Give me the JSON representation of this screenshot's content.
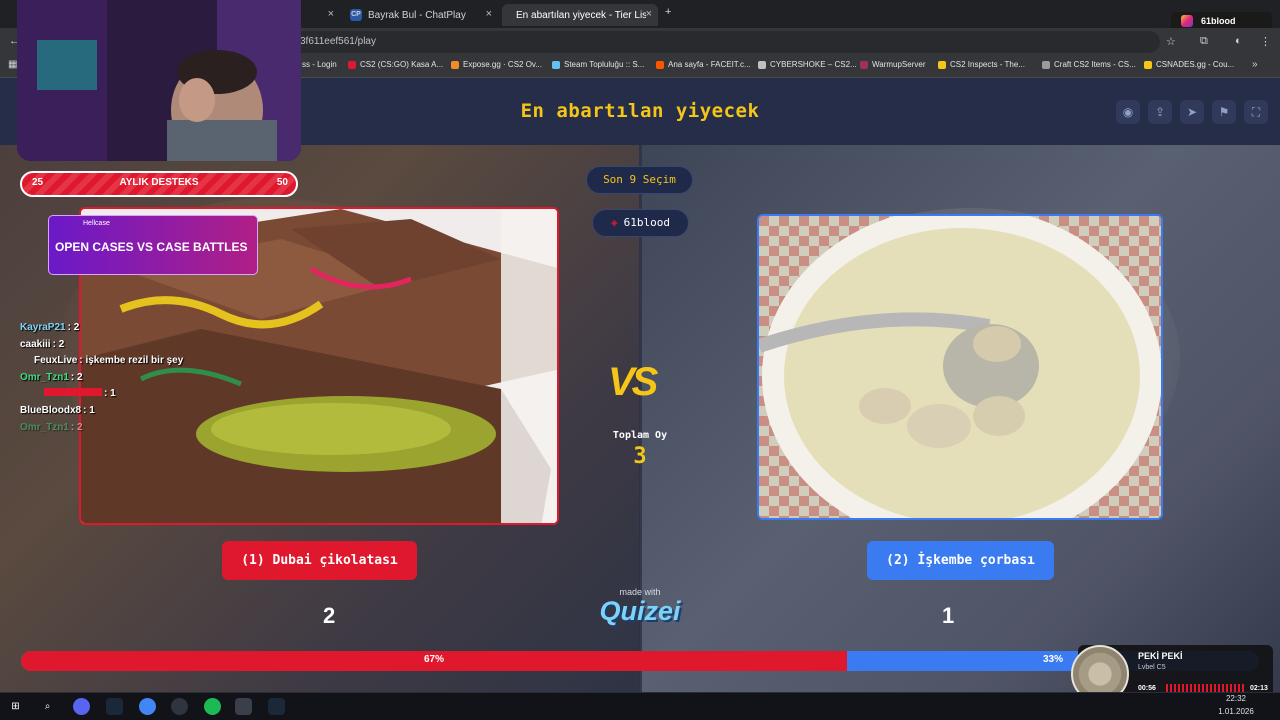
{
  "browser": {
    "tabs": [
      {
        "label": "",
        "icon": "tab-icon"
      },
      {
        "label": "Bayrak Bul - ChatPlay",
        "icon": "CP"
      },
      {
        "label": "En abartılan yiyecek - Tier List, ",
        "icon": "quizei-icon"
      }
    ],
    "new_tab": "+",
    "address": "3f611eef561/play",
    "bookmarks": [
      {
        "label": "ss - Login",
        "color": "#8ab4f8"
      },
      {
        "label": "CS2 (CS:GO) Kasa A...",
        "color": "#e0182d"
      },
      {
        "label": "Expose.gg · CS2 Ov...",
        "color": "#f28c28"
      },
      {
        "label": "Steam Topluluğu :: S...",
        "color": "#66c0f4"
      },
      {
        "label": "Ana sayfa - FACEIT.c...",
        "color": "#ff5500"
      },
      {
        "label": "CYBERSHOKE – CS2...",
        "color": "#c0c0c0"
      },
      {
        "label": "WarmupServer",
        "color": "#a03060"
      },
      {
        "label": "CS2 Inspects - The...",
        "color": "#f5c518"
      },
      {
        "label": "Craft CS2 Items - CS...",
        "color": "#9b9b9b"
      },
      {
        "label": "CSNADES.gg - Cou...",
        "color": "#f5c518"
      }
    ]
  },
  "quiz": {
    "title": "En abartılan yiyecek",
    "last_choices": "Son 9 Seçim",
    "user": "61blood",
    "vs": "VS",
    "total_label": "Toplam Oy",
    "total_value": "3",
    "made_with": "made with",
    "brand": "Quizei",
    "left": {
      "label": "(1) Dubai çikolatası",
      "count": "2",
      "percent": "67%",
      "share": 0.667,
      "color": "#e0182d"
    },
    "right": {
      "label": "(2) İşkembe çorbası",
      "count": "1",
      "percent": "33%",
      "share": 0.333,
      "color": "#3a7bf2"
    }
  },
  "overlay": {
    "support_label": "AYLIK DESTEKS",
    "support_min": "25",
    "support_max": "50",
    "sponsor_brand": "Hellcase",
    "sponsor_text": "OPEN CASES VS CASE BATTLES",
    "instagram": "61blood",
    "chat": [
      {
        "name": "KayraP21",
        "text": ": 2",
        "color": "#7dd3f7"
      },
      {
        "name": "caakiii",
        "text": ": 2",
        "color": "#ffffff"
      },
      {
        "name": "FeuxLive",
        "text": ": işkembe rezil bir şey",
        "color": "#ffffff"
      },
      {
        "name": "Omr_Tzn1",
        "text": ": 2",
        "color": "#3ddc84"
      },
      {
        "name": "",
        "text": ": 1",
        "color": "#e0182d"
      },
      {
        "name": "BlueBloodx8",
        "text": ": 1",
        "color": "#ffffff"
      },
      {
        "name": "Omr_Tzn1",
        "text": ": 2",
        "color": "#3ddc84"
      }
    ],
    "music": {
      "song": "PEKİ PEKİ",
      "artist": "Lvbel C5",
      "elapsed": "00:56",
      "duration": "02:13"
    }
  },
  "taskbar": {
    "time": "22:32",
    "date": "1.01.2026"
  }
}
